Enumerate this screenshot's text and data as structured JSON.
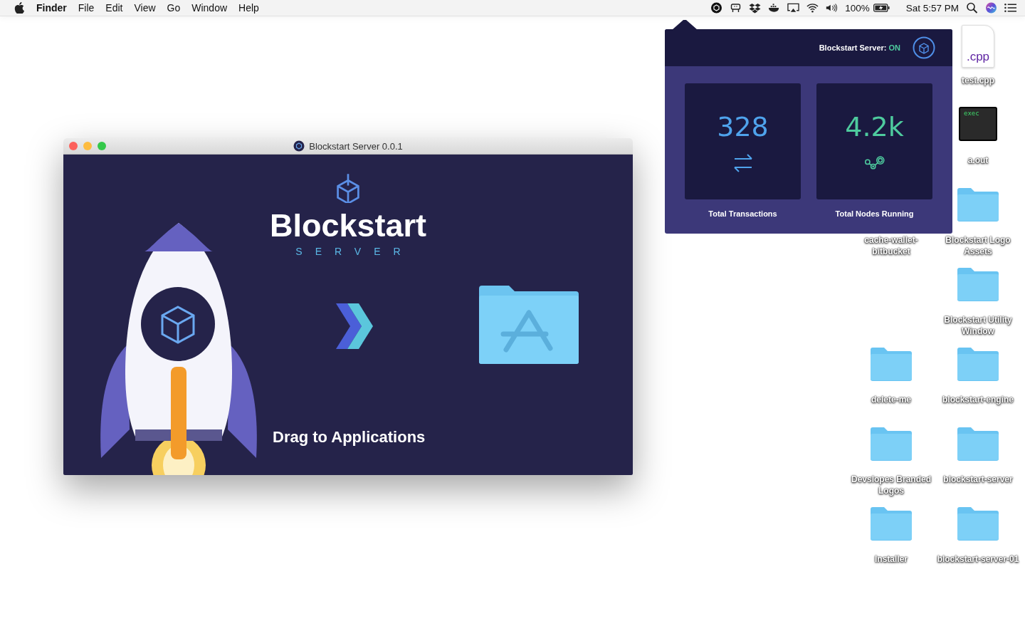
{
  "menu_bar": {
    "app_name": "Finder",
    "menus": [
      "File",
      "Edit",
      "View",
      "Go",
      "Window",
      "Help"
    ],
    "battery_percent": "100%",
    "clock": "Sat 5:57 PM"
  },
  "installer_window": {
    "title": "Blockstart Server 0.0.1",
    "logo_title": "Blockstart",
    "logo_subtitle": "SERVER",
    "instruction": "Drag to Applications"
  },
  "status_popup": {
    "label": "Blockstart Server:",
    "status": "ON",
    "on": true,
    "stats": [
      {
        "kind": "transactions",
        "value": "328",
        "label": "Total Transactions",
        "color": "#4fa3ec"
      },
      {
        "kind": "nodes",
        "value": "4.2k",
        "label": "Total Nodes Running",
        "color": "#4ecb9e"
      }
    ]
  },
  "desktop_items": [
    {
      "kind": "cpp-file",
      "name": "test.cpp",
      "badge": ".cpp"
    },
    {
      "kind": "executable",
      "name": "a.out",
      "badge": "exec"
    },
    {
      "kind": "covered",
      "name": "cache-wallet-bitbucket"
    },
    {
      "kind": "folder",
      "name": "Blockstart Logo Assets"
    },
    {
      "kind": "folder",
      "name": "Blockstart Utility Window"
    },
    {
      "kind": "folder",
      "name": "delete-me"
    },
    {
      "kind": "folder",
      "name": "blockstart-engine"
    },
    {
      "kind": "folder",
      "name": "Devslopes Branded Logos"
    },
    {
      "kind": "folder",
      "name": "blockstart-server"
    },
    {
      "kind": "folder",
      "name": "Installer"
    },
    {
      "kind": "folder",
      "name": "blockstart-server-01"
    }
  ]
}
